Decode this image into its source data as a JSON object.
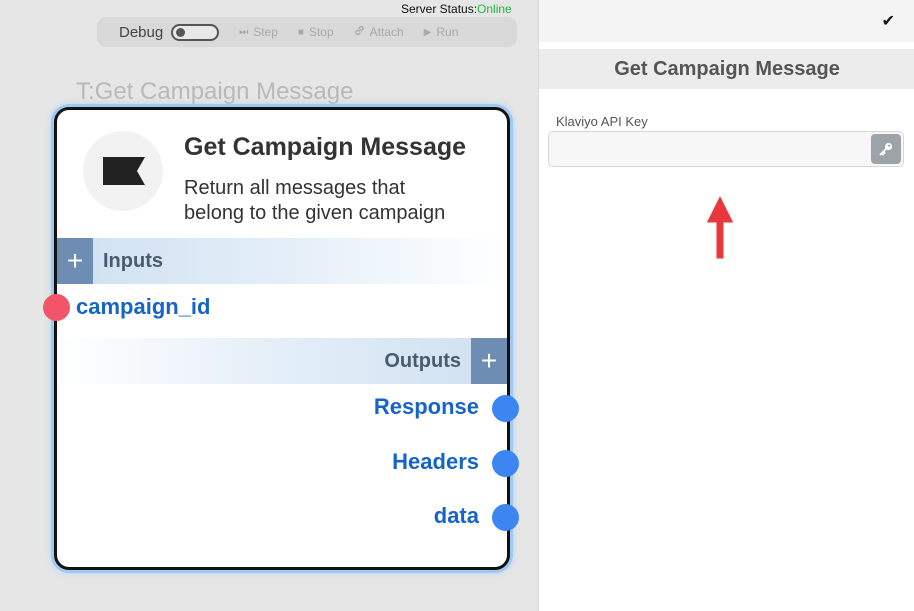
{
  "server_status": {
    "label": "Server Status:",
    "value": "Online",
    "value_color": "#22b64a"
  },
  "toolbar": {
    "debug_label": "Debug",
    "buttons": [
      {
        "label": "Step",
        "icon": "step-icon"
      },
      {
        "label": "Stop",
        "icon": "stop-icon"
      },
      {
        "label": "Attach",
        "icon": "link-icon"
      },
      {
        "label": "Run",
        "icon": "play-icon"
      }
    ]
  },
  "canvas": {
    "node_caption": "T:Get Campaign Message"
  },
  "node": {
    "title": "Get Campaign Message",
    "description": "Return all messages that belong to the given campaign",
    "icon": "klaviyo-flag-icon",
    "inputs_label": "Inputs",
    "outputs_label": "Outputs",
    "inputs": [
      "campaign_id"
    ],
    "outputs": [
      "Response",
      "Headers",
      "data"
    ]
  },
  "panel": {
    "confirm_icon": "check-icon",
    "title": "Get Campaign Message",
    "field_label": "Klaviyo API Key",
    "field_value": "",
    "field_button_icon": "key-icon"
  },
  "colors": {
    "accent": "#1565c8",
    "input_port": "#f2556a",
    "output_port": "#3d86f2",
    "section_button": "#6d8db3",
    "annotation_arrow": "#e8383d"
  }
}
